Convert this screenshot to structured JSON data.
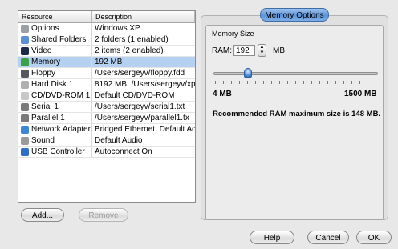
{
  "table": {
    "headers": [
      "Resource",
      "Description"
    ],
    "rows": [
      {
        "name": "Options",
        "desc": "Windows XP",
        "icon": "gear-icon",
        "color": "#9aa0a8",
        "selected": false
      },
      {
        "name": "Shared Folders",
        "desc": "2 folders (1 enabled)",
        "icon": "folder-icon",
        "color": "#5b8fd6",
        "selected": false
      },
      {
        "name": "Video",
        "desc": "2 items (2 enabled)",
        "icon": "monitor-icon",
        "color": "#1d2b4a",
        "selected": false
      },
      {
        "name": "Memory",
        "desc": "192 MB",
        "icon": "memory-icon",
        "color": "#3aa04a",
        "selected": true
      },
      {
        "name": "Floppy",
        "desc": "/Users/sergeyv/floppy.fdd",
        "icon": "floppy-icon",
        "color": "#55585e",
        "selected": false
      },
      {
        "name": "Hard Disk 1",
        "desc": "8192 MB; /Users/sergeyv/xp",
        "icon": "hard-disk-icon",
        "color": "#b0b0b0",
        "selected": false
      },
      {
        "name": "CD/DVD-ROM 1",
        "desc": "Default CD/DVD-ROM",
        "icon": "cd-icon",
        "color": "#c8c8c8",
        "selected": false
      },
      {
        "name": "Serial 1",
        "desc": "/Users/sergeyv/serial1.txt",
        "icon": "serial-port-icon",
        "color": "#7a7a7a",
        "selected": false
      },
      {
        "name": "Parallel 1",
        "desc": "/Users/sergeyv/parallel1.tx",
        "icon": "parallel-port-icon",
        "color": "#7a7a7a",
        "selected": false
      },
      {
        "name": "Network Adapter",
        "desc": "Bridged Ethernet; Default Ad",
        "icon": "network-icon",
        "color": "#3c86d8",
        "selected": false
      },
      {
        "name": "Sound",
        "desc": "Default Audio",
        "icon": "sound-icon",
        "color": "#9a9a9a",
        "selected": false
      },
      {
        "name": "USB Controller",
        "desc": "Autoconnect On",
        "icon": "usb-icon",
        "color": "#2f6fc4",
        "selected": false
      }
    ]
  },
  "buttons": {
    "add": "Add...",
    "remove": "Remove",
    "help": "Help",
    "cancel": "Cancel",
    "ok": "OK"
  },
  "memory": {
    "tab": "Memory Options",
    "section": "Memory Size",
    "ram_label": "RAM:",
    "ram_value": "192",
    "unit": "MB",
    "min_label": "4 MB",
    "max_label": "1500 MB",
    "slider_value": 192,
    "slider_min": 4,
    "slider_max": 1500,
    "recommendation": "Recommended RAM maximum size is 148 MB."
  }
}
